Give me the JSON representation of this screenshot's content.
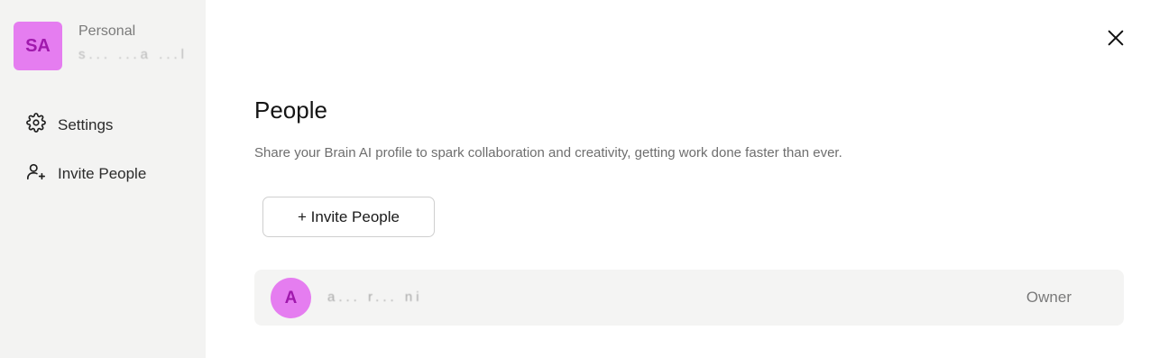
{
  "sidebar": {
    "workspace": {
      "initials": "SA",
      "type": "Personal",
      "name": "s... ...a ...l"
    },
    "items": [
      {
        "label": "Settings",
        "icon": "gear-icon"
      },
      {
        "label": "Invite People",
        "icon": "user-plus-icon"
      }
    ]
  },
  "main": {
    "title": "People",
    "description": "Share your Brain AI profile to spark collaboration and creativity, getting work done faster than ever.",
    "invite_button": "+ Invite People",
    "members": [
      {
        "initial": "A",
        "name": "a... r... ni",
        "role": "Owner"
      }
    ]
  },
  "colors": {
    "avatar_bg": "#e57df0",
    "avatar_text": "#a019ad",
    "sidebar_bg": "#f3f3f2",
    "row_bg": "#f4f4f3"
  }
}
